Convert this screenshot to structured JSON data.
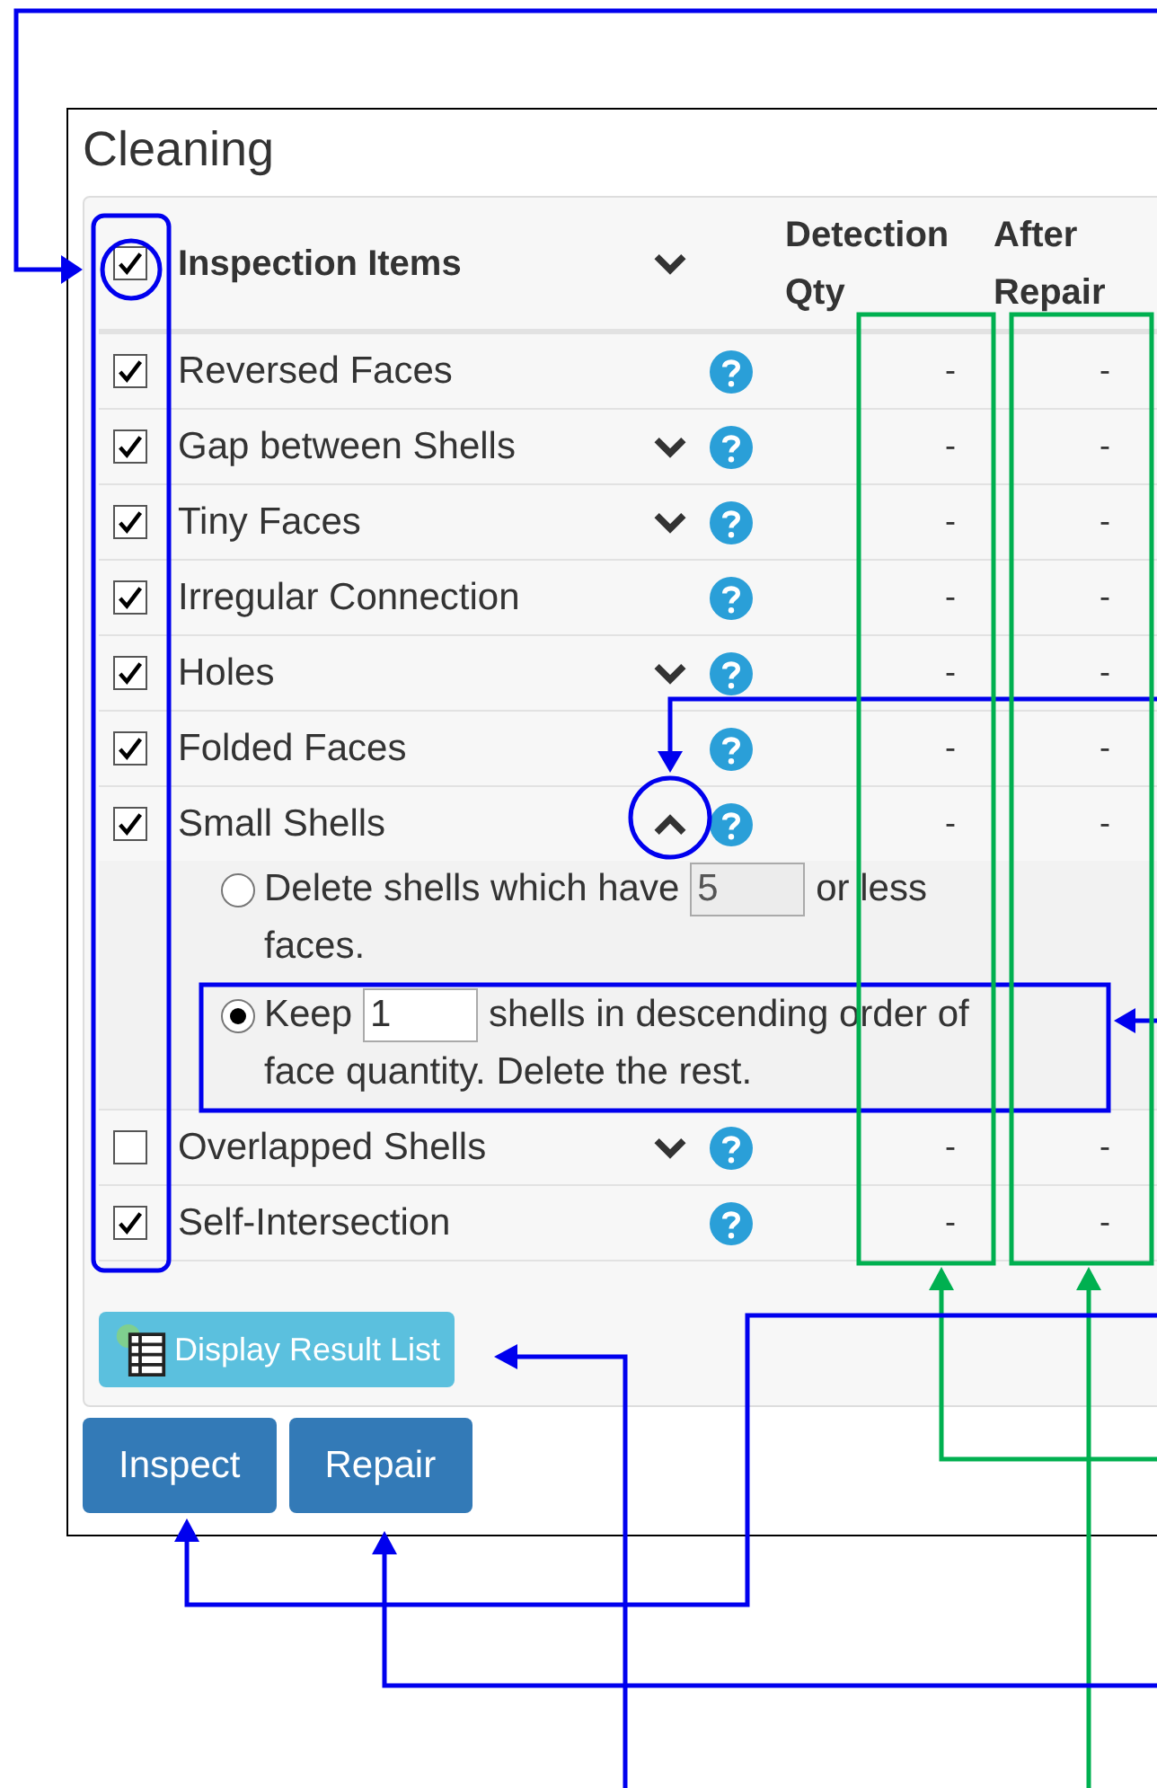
{
  "panel": {
    "title": "Cleaning"
  },
  "header": {
    "checked": true,
    "label": "Inspection Items",
    "columns": [
      "Detection Qty",
      "After Repair"
    ]
  },
  "items": [
    {
      "label": "Reversed Faces",
      "checked": true,
      "expandable": false,
      "detection": "-",
      "after_repair": "-"
    },
    {
      "label": "Gap between Shells",
      "checked": true,
      "expandable": true,
      "expanded": false,
      "detection": "-",
      "after_repair": "-"
    },
    {
      "label": "Tiny Faces",
      "checked": true,
      "expandable": true,
      "expanded": false,
      "detection": "-",
      "after_repair": "-"
    },
    {
      "label": "Irregular Connection",
      "checked": true,
      "expandable": false,
      "detection": "-",
      "after_repair": "-"
    },
    {
      "label": "Holes",
      "checked": true,
      "expandable": true,
      "expanded": false,
      "detection": "-",
      "after_repair": "-"
    },
    {
      "label": "Folded Faces",
      "checked": true,
      "expandable": false,
      "detection": "-",
      "after_repair": "-"
    },
    {
      "label": "Small Shells",
      "checked": true,
      "expandable": true,
      "expanded": true,
      "detection": "-",
      "after_repair": "-",
      "options": [
        {
          "selected": false,
          "before": "Delete shells which have",
          "value": "5",
          "after": "or less",
          "next_line": "faces."
        },
        {
          "selected": true,
          "before": "Keep",
          "value": "1",
          "after": "shells in descending order of",
          "next_line": "face quantity. Delete the rest."
        }
      ]
    },
    {
      "label": "Overlapped Shells",
      "checked": false,
      "expandable": true,
      "expanded": false,
      "detection": "-",
      "after_repair": "-"
    },
    {
      "label": "Self-Intersection",
      "checked": true,
      "expandable": false,
      "detection": "-",
      "after_repair": "-"
    }
  ],
  "result_button": "Display Result List",
  "buttons": [
    "Inspect",
    "Repair"
  ]
}
